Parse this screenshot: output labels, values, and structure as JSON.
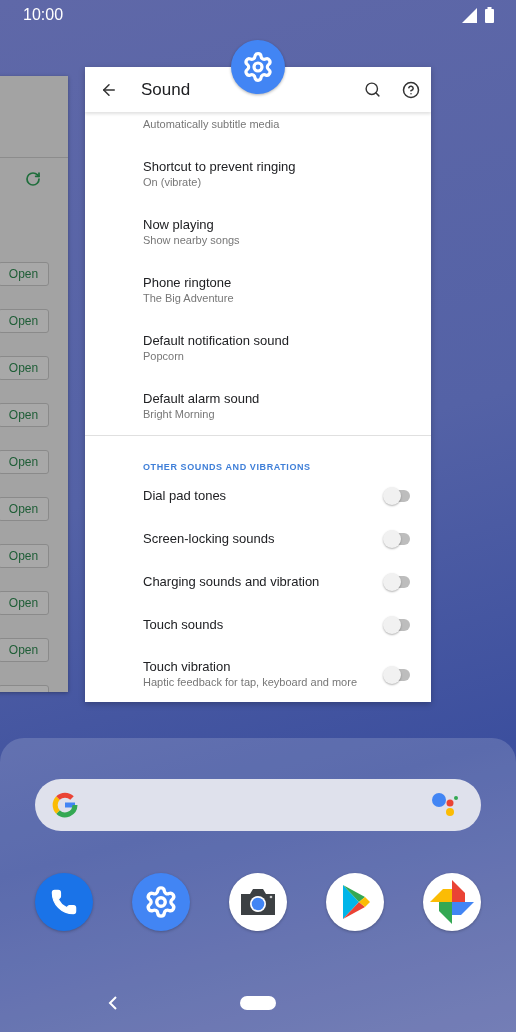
{
  "status_bar": {
    "time": "10:00"
  },
  "background_app": {
    "open_buttons": [
      "Open",
      "Open",
      "Open",
      "Open",
      "Open",
      "Open",
      "Open",
      "Open",
      "Open"
    ]
  },
  "settings_card": {
    "title": "Sound",
    "items": [
      {
        "kind": "text",
        "subtitle": "Automatically subtitle media"
      },
      {
        "kind": "text",
        "title": "Shortcut to prevent ringing",
        "subtitle": "On (vibrate)"
      },
      {
        "kind": "text",
        "title": "Now playing",
        "subtitle": "Show nearby songs"
      },
      {
        "kind": "text",
        "title": "Phone ringtone",
        "subtitle": "The Big Adventure"
      },
      {
        "kind": "text",
        "title": "Default notification sound",
        "subtitle": "Popcorn"
      },
      {
        "kind": "text",
        "title": "Default alarm sound",
        "subtitle": "Bright Morning"
      },
      {
        "kind": "header",
        "title": "OTHER SOUNDS AND VIBRATIONS"
      },
      {
        "kind": "switch",
        "title": "Dial pad tones",
        "on": false
      },
      {
        "kind": "switch",
        "title": "Screen-locking sounds",
        "on": false
      },
      {
        "kind": "switch",
        "title": "Charging sounds and vibration",
        "on": false
      },
      {
        "kind": "switch",
        "title": "Touch sounds",
        "on": false
      },
      {
        "kind": "switch",
        "title": "Touch vibration",
        "subtitle": "Haptic feedback for tap, keyboard and more",
        "on": false
      }
    ]
  },
  "dock": {
    "apps": [
      {
        "kind": "phone"
      },
      {
        "kind": "settings"
      },
      {
        "kind": "camera"
      },
      {
        "kind": "store"
      },
      {
        "kind": "photos"
      }
    ]
  }
}
